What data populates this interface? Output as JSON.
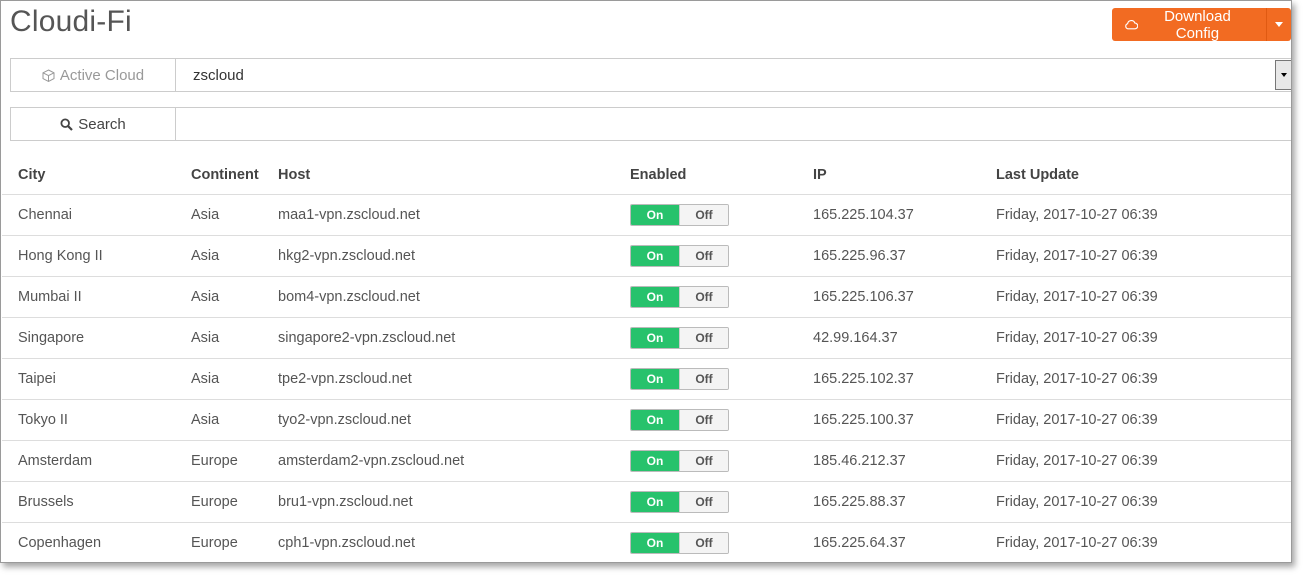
{
  "app": {
    "title": "Cloudi-Fi"
  },
  "download": {
    "label": "Download Config",
    "icon": "cloud-icon",
    "color": "#f26b22"
  },
  "cloud_select": {
    "label": "Active Cloud",
    "icon": "cube-icon",
    "value": "zscloud"
  },
  "search": {
    "label": "Search",
    "icon": "search-icon",
    "value": ""
  },
  "table": {
    "headers": {
      "city": "City",
      "continent": "Continent",
      "host": "Host",
      "enabled": "Enabled",
      "ip": "IP",
      "last_update": "Last Update"
    },
    "toggle": {
      "on": "On",
      "off": "Off",
      "on_color": "#27c26c"
    },
    "rows": [
      {
        "city": "Chennai",
        "continent": "Asia",
        "host": "maa1-vpn.zscloud.net",
        "enabled": true,
        "ip": "165.225.104.37",
        "last_update": "Friday, 2017-10-27 06:39"
      },
      {
        "city": "Hong Kong II",
        "continent": "Asia",
        "host": "hkg2-vpn.zscloud.net",
        "enabled": true,
        "ip": "165.225.96.37",
        "last_update": "Friday, 2017-10-27 06:39"
      },
      {
        "city": "Mumbai II",
        "continent": "Asia",
        "host": "bom4-vpn.zscloud.net",
        "enabled": true,
        "ip": "165.225.106.37",
        "last_update": "Friday, 2017-10-27 06:39"
      },
      {
        "city": "Singapore",
        "continent": "Asia",
        "host": "singapore2-vpn.zscloud.net",
        "enabled": true,
        "ip": "42.99.164.37",
        "last_update": "Friday, 2017-10-27 06:39"
      },
      {
        "city": "Taipei",
        "continent": "Asia",
        "host": "tpe2-vpn.zscloud.net",
        "enabled": true,
        "ip": "165.225.102.37",
        "last_update": "Friday, 2017-10-27 06:39"
      },
      {
        "city": "Tokyo II",
        "continent": "Asia",
        "host": "tyo2-vpn.zscloud.net",
        "enabled": true,
        "ip": "165.225.100.37",
        "last_update": "Friday, 2017-10-27 06:39"
      },
      {
        "city": "Amsterdam",
        "continent": "Europe",
        "host": "amsterdam2-vpn.zscloud.net",
        "enabled": true,
        "ip": "185.46.212.37",
        "last_update": "Friday, 2017-10-27 06:39"
      },
      {
        "city": "Brussels",
        "continent": "Europe",
        "host": "bru1-vpn.zscloud.net",
        "enabled": true,
        "ip": "165.225.88.37",
        "last_update": "Friday, 2017-10-27 06:39"
      },
      {
        "city": "Copenhagen",
        "continent": "Europe",
        "host": "cph1-vpn.zscloud.net",
        "enabled": true,
        "ip": "165.225.64.37",
        "last_update": "Friday, 2017-10-27 06:39"
      }
    ]
  }
}
